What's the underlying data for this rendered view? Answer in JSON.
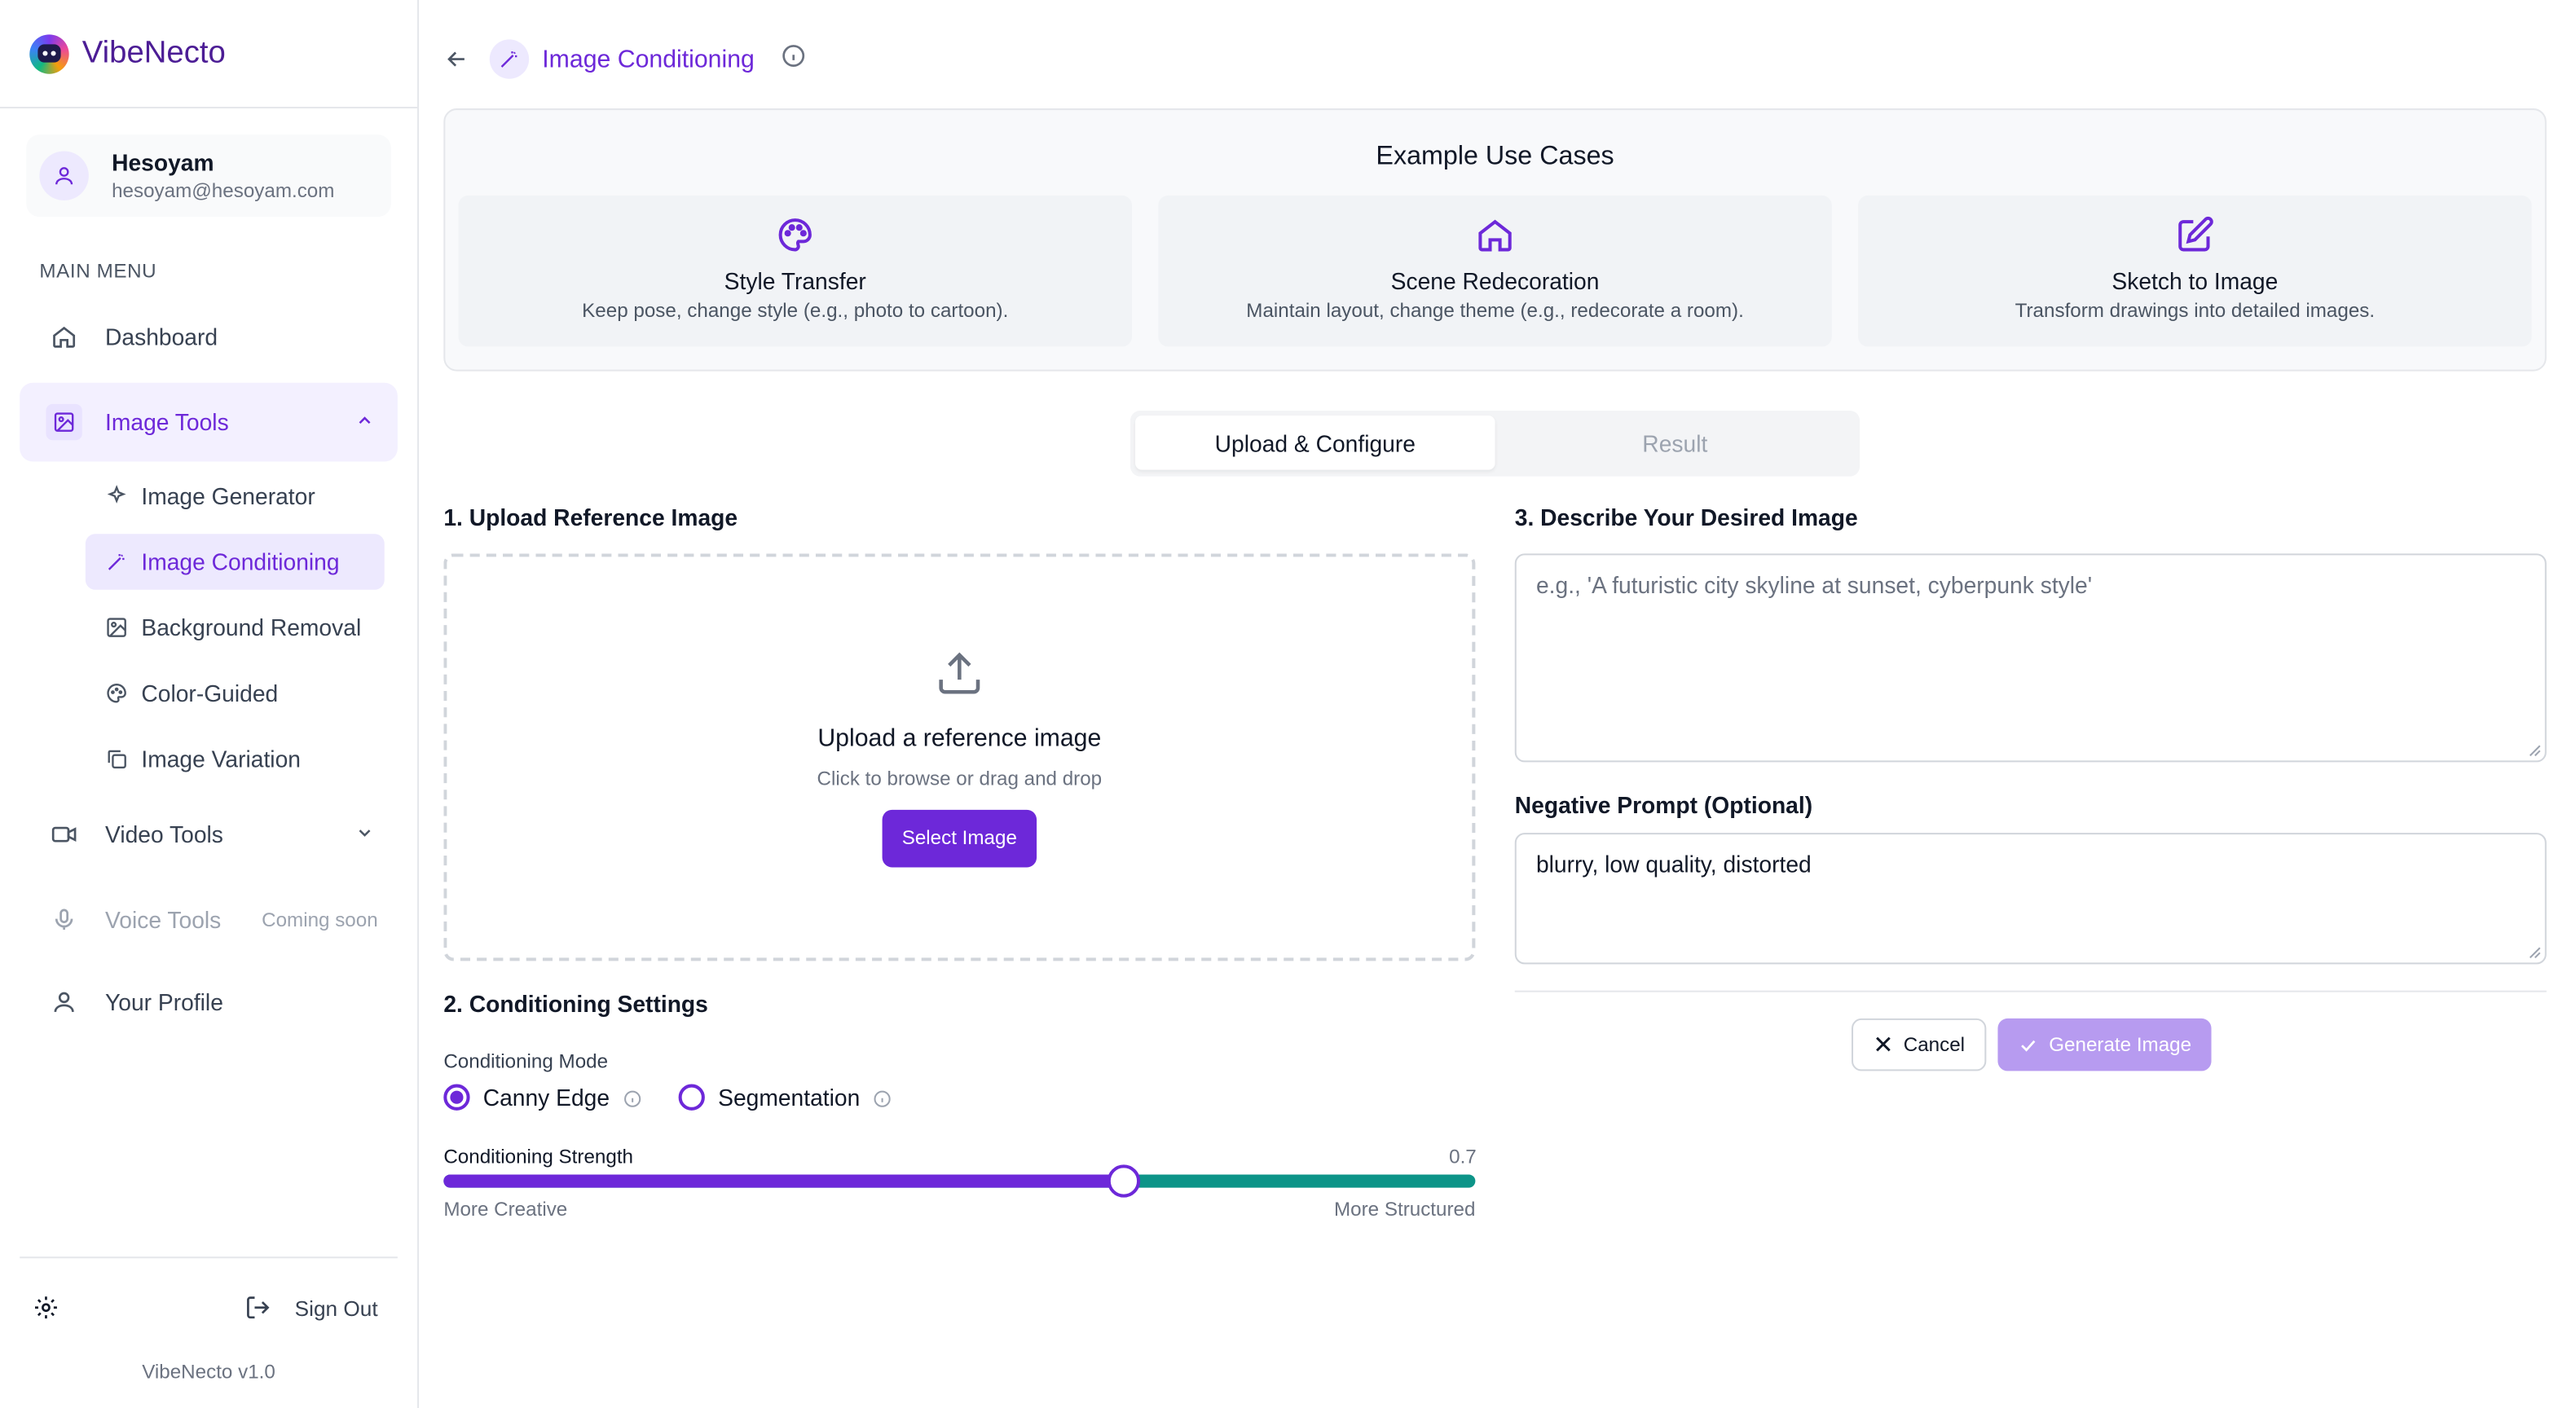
{
  "app": {
    "name": "VibeNecto",
    "version": "VibeNecto v1.0"
  },
  "user": {
    "name": "Hesoyam",
    "email": "hesoyam@hesoyam.com"
  },
  "sidebar": {
    "menu_title": "MAIN MENU",
    "dashboard": "Dashboard",
    "image_tools": "Image Tools",
    "image_subitems": [
      "Image Generator",
      "Image Conditioning",
      "Background Removal",
      "Color-Guided",
      "Image Variation"
    ],
    "video_tools": "Video Tools",
    "voice_tools": "Voice Tools",
    "voice_badge": "Coming soon",
    "profile": "Your Profile",
    "sign_out": "Sign Out"
  },
  "page": {
    "title": "Image Conditioning"
  },
  "examples": {
    "title": "Example Use Cases",
    "cards": [
      {
        "title": "Style Transfer",
        "desc": "Keep pose, change style (e.g., photo to cartoon).",
        "icon": "palette-icon"
      },
      {
        "title": "Scene Redecoration",
        "desc": "Maintain layout, change theme (e.g., redecorate a room).",
        "icon": "home-icon"
      },
      {
        "title": "Sketch to Image",
        "desc": "Transform drawings into detailed images.",
        "icon": "edit-icon"
      }
    ]
  },
  "tabs": {
    "upload": "Upload & Configure",
    "result": "Result"
  },
  "upload": {
    "heading": "1. Upload Reference Image",
    "title": "Upload a reference image",
    "subtitle": "Click to browse or drag and drop",
    "button": "Select Image"
  },
  "settings": {
    "heading": "2. Conditioning Settings",
    "mode_label": "Conditioning Mode",
    "mode_options": [
      "Canny Edge",
      "Segmentation"
    ],
    "selected_mode": "Canny Edge",
    "strength_label": "Conditioning Strength",
    "strength_value": "0.7",
    "strength_fraction": 0.66,
    "min_label": "More Creative",
    "max_label": "More Structured"
  },
  "describe": {
    "heading": "3. Describe Your Desired Image",
    "placeholder": "e.g., 'A futuristic city skyline at sunset, cyberpunk style'",
    "negative_heading": "Negative Prompt (Optional)",
    "negative_value": "blurry, low quality, distorted"
  },
  "actions": {
    "cancel": "Cancel",
    "generate": "Generate Image"
  },
  "colors": {
    "accent": "#6d28d9",
    "slider_track": "#0d9488",
    "generate_disabled": "#b79bf0"
  }
}
